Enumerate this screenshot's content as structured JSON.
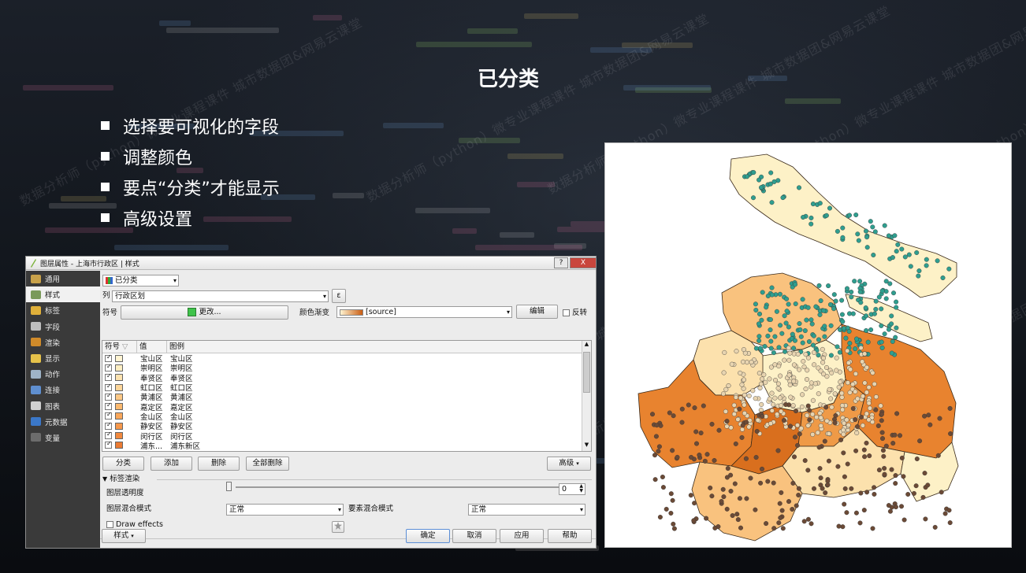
{
  "slide": {
    "title": "已分类",
    "bullets": [
      "选择要可视化的字段",
      "调整颜色",
      "要点“分类”才能显示",
      "高级设置"
    ],
    "watermark": "数据分析师（python）微专业课程课件 城市数据团&网易云课堂"
  },
  "dialog": {
    "title": "图层属性 - 上海市行政区 | 样式",
    "help_label": "?",
    "close_label": "X",
    "nav": [
      {
        "label": "通用",
        "icon": "wrench-icon",
        "color": "#c9a24a"
      },
      {
        "label": "样式",
        "icon": "brush-icon",
        "color": "#7a9a5a"
      },
      {
        "label": "标签",
        "icon": "abc-label-icon",
        "color": "#e0b03a"
      },
      {
        "label": "字段",
        "icon": "table-icon",
        "color": "#bfbfbf"
      },
      {
        "label": "渲染",
        "icon": "paint-icon",
        "color": "#d08b2a"
      },
      {
        "label": "显示",
        "icon": "speech-bubble-icon",
        "color": "#e6c24a"
      },
      {
        "label": "动作",
        "icon": "gear-icon",
        "color": "#9fb4c8"
      },
      {
        "label": "连接",
        "icon": "join-icon",
        "color": "#5f8fd0"
      },
      {
        "label": "图表",
        "icon": "chart-icon",
        "color": "#cfcfcf"
      },
      {
        "label": "元数据",
        "icon": "info-icon",
        "color": "#3b78c9"
      },
      {
        "label": "变量",
        "icon": "variable-icon",
        "color": "#6c6c6c"
      }
    ],
    "renderer": "已分类",
    "column_label": "列",
    "column_value": "行政区划",
    "epsilon_label": "ε",
    "symbol_label": "符号",
    "change_label": "更改...",
    "colorramp_label": "颜色渐变",
    "colorramp_value": "[source]",
    "edit_label": "编辑",
    "invert_label": "反转",
    "table": {
      "headers": [
        "符号",
        "值",
        "图例"
      ],
      "rows": [
        {
          "value": "宝山区",
          "legend": "宝山区",
          "color": "#fff4d2"
        },
        {
          "value": "崇明区",
          "legend": "崇明区",
          "color": "#fdeec2"
        },
        {
          "value": "奉贤区",
          "legend": "奉贤区",
          "color": "#fde3b0"
        },
        {
          "value": "虹口区",
          "legend": "虹口区",
          "color": "#fdd69a"
        },
        {
          "value": "黄浦区",
          "legend": "黄浦区",
          "color": "#fcc886"
        },
        {
          "value": "嘉定区",
          "legend": "嘉定区",
          "color": "#fbb96f"
        },
        {
          "value": "金山区",
          "legend": "金山区",
          "color": "#f9a75b"
        },
        {
          "value": "静安区",
          "legend": "静安区",
          "color": "#f6984c"
        },
        {
          "value": "闵行区",
          "legend": "闵行区",
          "color": "#f1893e"
        },
        {
          "value": "浦东...",
          "legend": "浦东新区",
          "color": "#eb7b33"
        }
      ]
    },
    "buttons": {
      "classify": "分类",
      "add": "添加",
      "delete": "删除",
      "delete_all": "全部删除",
      "advanced": "高级"
    },
    "layer_rendering": {
      "section_label": "标签渲染",
      "opacity_label": "图层透明度",
      "opacity_value": "0",
      "layer_blend_label": "图层混合模式",
      "layer_blend_value": "正常",
      "feature_blend_label": "要素混合模式",
      "feature_blend_value": "正常",
      "draw_effects_label": "Draw effects"
    },
    "footer": {
      "style_label": "样式",
      "ok": "确定",
      "cancel": "取消",
      "apply": "应用",
      "help": "帮助"
    }
  },
  "map": {
    "district_fills": [
      "#fdf1c7",
      "#fce1ad",
      "#f9c27e",
      "#ef9a47",
      "#e8832f",
      "#d96f1e",
      "#c95d12"
    ],
    "point_colors": [
      "#2f9e8f",
      "#e8d4b0",
      "#6b4a36"
    ]
  }
}
